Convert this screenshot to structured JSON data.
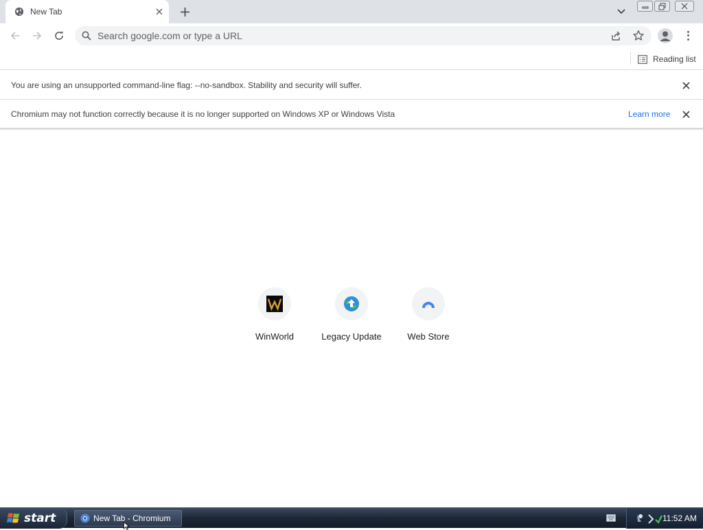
{
  "tab": {
    "title": "New Tab",
    "favicon": "globe-icon"
  },
  "omnibox": {
    "placeholder": "Search google.com or type a URL"
  },
  "bookmarks": {
    "reading_list": "Reading list"
  },
  "infobars": [
    {
      "text": "You are using an unsupported command-line flag: --no-sandbox. Stability and security will suffer."
    },
    {
      "text": "Chromium may not function correctly because it is no longer supported on Windows XP or Windows Vista",
      "link": "Learn more"
    }
  ],
  "shortcuts": [
    {
      "label": "WinWorld",
      "icon": "winworld-icon"
    },
    {
      "label": "Legacy Update",
      "icon": "legacy-update-icon"
    },
    {
      "label": "Web Store",
      "icon": "web-store-icon"
    }
  ],
  "taskbar": {
    "start_label": "start",
    "task_title": "New Tab - Chromium",
    "clock": "11:52 AM"
  },
  "colors": {
    "link": "#1a73e8",
    "tabstrip": "#dee1e6",
    "taskbar": "#1d2736"
  }
}
